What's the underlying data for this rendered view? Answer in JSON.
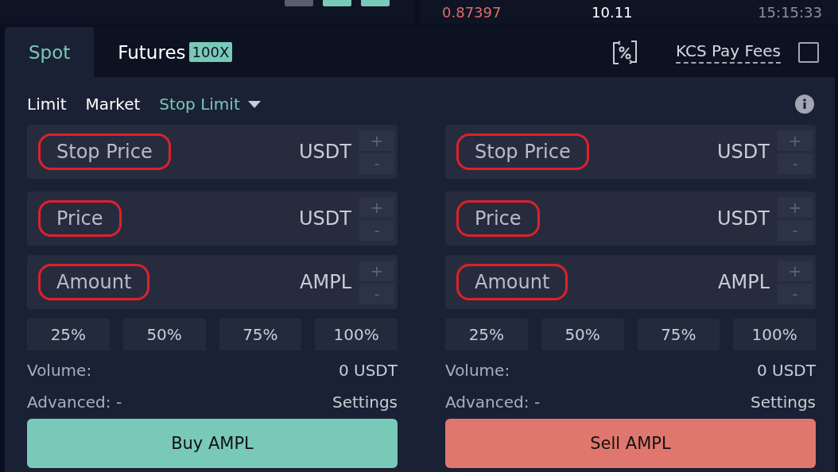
{
  "top_strip": {
    "left_buttons": [
      {
        "color": "#5a5f6b"
      },
      {
        "color": "#79c9b8"
      },
      {
        "color": "#79c9b8"
      }
    ],
    "trade": {
      "price": "0.87397",
      "amount": "10.11",
      "time": "15:15:33"
    }
  },
  "tabs": [
    {
      "label": "Spot",
      "selected": true
    },
    {
      "label": "Futures",
      "selected": false,
      "badge": "100X"
    }
  ],
  "fee_option": {
    "label": "KCS Pay Fees",
    "checked": false
  },
  "order_types": [
    {
      "label": "Limit",
      "selected": false
    },
    {
      "label": "Market",
      "selected": false
    },
    {
      "label": "Stop Limit",
      "selected": true,
      "dropdown": true
    }
  ],
  "forms": [
    {
      "kind": "buy",
      "fields": [
        {
          "placeholder": "Stop Price",
          "unit": "USDT",
          "highlighted": true,
          "steppers": [
            "+",
            "-"
          ]
        },
        {
          "placeholder": "Price",
          "unit": "USDT",
          "highlighted": true,
          "steppers": [
            "+",
            "-"
          ]
        },
        {
          "placeholder": "Amount",
          "unit": "AMPL",
          "highlighted": true,
          "steppers": [
            "+",
            "-"
          ]
        }
      ],
      "percents": [
        "25%",
        "50%",
        "75%",
        "100%"
      ],
      "volume_label": "Volume:",
      "volume_value": "0 USDT",
      "advanced_label": "Advanced: -",
      "settings": "Settings",
      "submit": "Buy AMPL"
    },
    {
      "kind": "sell",
      "fields": [
        {
          "placeholder": "Stop Price",
          "unit": "USDT",
          "highlighted": true,
          "steppers": [
            "+",
            "-"
          ]
        },
        {
          "placeholder": "Price",
          "unit": "USDT",
          "highlighted": true,
          "steppers": [
            "+",
            "-"
          ]
        },
        {
          "placeholder": "Amount",
          "unit": "AMPL",
          "highlighted": true,
          "steppers": [
            "+",
            "-"
          ]
        }
      ],
      "percents": [
        "25%",
        "50%",
        "75%",
        "100%"
      ],
      "volume_label": "Volume:",
      "volume_value": "0 USDT",
      "advanced_label": "Advanced: -",
      "settings": "Settings",
      "submit": "Sell AMPL"
    }
  ]
}
